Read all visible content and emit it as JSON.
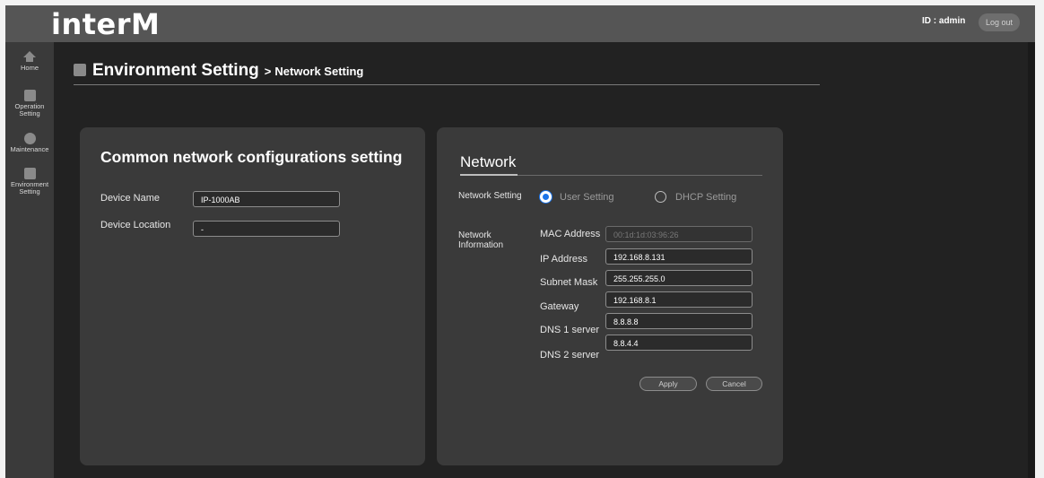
{
  "header": {
    "logo": "interM",
    "user_id": "ID : admin",
    "logout_label": "Log out"
  },
  "sidebar": {
    "items": [
      {
        "label": "Home",
        "icon": "home-icon"
      },
      {
        "label": "Operation Setting",
        "icon": "chart-icon"
      },
      {
        "label": "Maintenance",
        "icon": "wrench-icon"
      },
      {
        "label": "Environment Setting",
        "icon": "gear-icon"
      }
    ]
  },
  "page": {
    "title": "Environment Setting",
    "separator": ">",
    "subtitle": "Network Setting"
  },
  "common": {
    "heading": "Common network configurations setting",
    "device_name_label": "Device Name",
    "device_name_value": "IP-1000AB",
    "device_location_label": "Device Location",
    "device_location_value": "-"
  },
  "network": {
    "heading": "Network",
    "setting_label": "Network Setting",
    "user_setting_label": "User Setting",
    "dhcp_setting_label": "DHCP Setting",
    "selected_mode": "User Setting",
    "info_label": "Network Information",
    "fields": [
      {
        "label": "MAC Address",
        "value": "00:1d:1d:03:96:26",
        "disabled": true
      },
      {
        "label": "IP Address",
        "value": "192.168.8.131"
      },
      {
        "label": "Subnet Mask",
        "value": "255.255.255.0"
      },
      {
        "label": "Gateway",
        "value": "192.168.8.1"
      },
      {
        "label": "DNS 1 server",
        "value": "8.8.8.8"
      },
      {
        "label": "DNS 2 server",
        "value": "8.8.4.4"
      }
    ],
    "apply_label": "Apply",
    "cancel_label": "Cancel"
  },
  "colors": {
    "accent": "#1a73e8",
    "background": "#222222",
    "card": "#3a3a3a",
    "topbar": "#555555"
  }
}
